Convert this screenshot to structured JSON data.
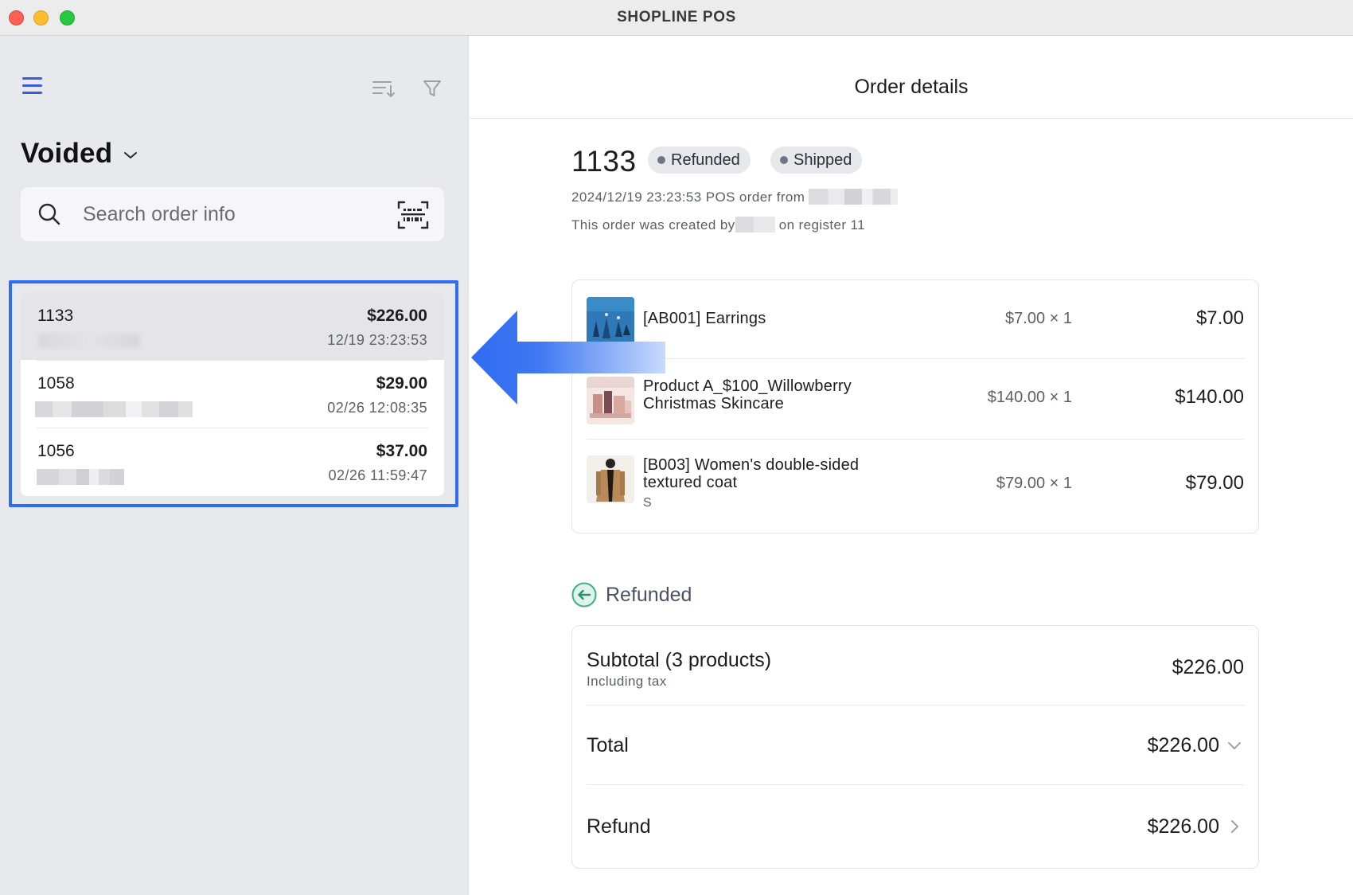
{
  "window": {
    "title": "SHOPLINE POS"
  },
  "sidebar": {
    "filter_label": "Voided",
    "search": {
      "placeholder": "Search order info",
      "value": ""
    },
    "orders": [
      {
        "number": "1133",
        "amount": "$226.00",
        "datetime": "12/19 23:23:53",
        "selected": true
      },
      {
        "number": "1058",
        "amount": "$29.00",
        "datetime": "02/26 12:08:35",
        "selected": false
      },
      {
        "number": "1056",
        "amount": "$37.00",
        "datetime": "02/26 11:59:47",
        "selected": false
      }
    ]
  },
  "main": {
    "header_title": "Order details",
    "order": {
      "number": "1133",
      "badges": [
        "Refunded",
        "Shipped"
      ],
      "created_line_prefix": "2024/12/19 23:23:53 POS order from",
      "creator_line_prefix": "This order was created by",
      "creator_line_suffix": "on register 11"
    },
    "items": [
      {
        "name_line1": "[AB001] Earrings",
        "name_line2": "",
        "variant": "",
        "qty_price": "$7.00 × 1",
        "total": "$7.00",
        "thumb_icon": "earrings-thumbnail"
      },
      {
        "name_line1": "Product A_$100_Willowberry",
        "name_line2": "Christmas Skincare",
        "variant": "",
        "qty_price": "$140.00 × 1",
        "total": "$140.00",
        "thumb_icon": "skincare-thumbnail"
      },
      {
        "name_line1": "[B003] Women's double-sided",
        "name_line2": "textured coat",
        "variant": "S",
        "qty_price": "$79.00 × 1",
        "total": "$79.00",
        "thumb_icon": "coat-thumbnail"
      }
    ],
    "payment_status": {
      "label": "Refunded",
      "icon": "refund-arrow-icon"
    },
    "totals": {
      "subtotal_label": "Subtotal (3 products)",
      "subtotal_note": "Including tax",
      "subtotal_value": "$226.00",
      "total_label": "Total",
      "total_value": "$226.00",
      "refund_label": "Refund",
      "refund_value": "$226.00"
    }
  },
  "colors": {
    "accent": "#3b5bdb",
    "highlight_frame": "#2f6cf2",
    "sidebar_bg": "#e8e9ed",
    "refund_icon": "#3fae8c"
  }
}
